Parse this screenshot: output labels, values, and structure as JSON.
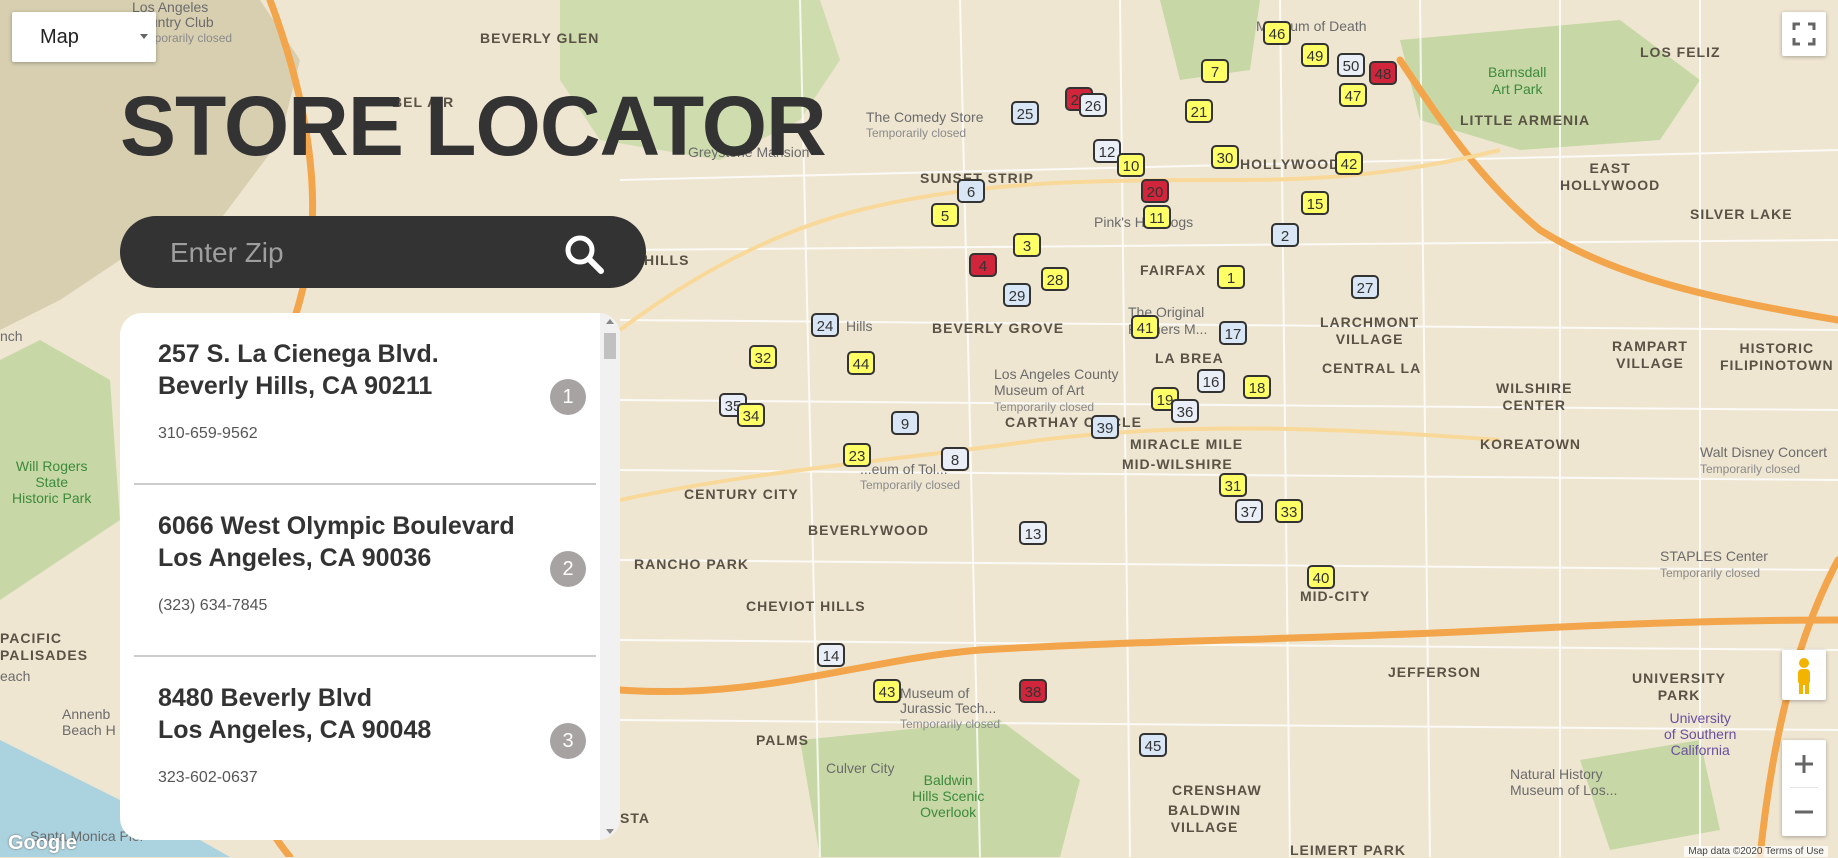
{
  "map_type": {
    "label": "Map"
  },
  "title": "STORE LOCATOR",
  "search": {
    "placeholder": "Enter Zip"
  },
  "stores": [
    {
      "line1": "257 S. La Cienega Blvd.",
      "line2": "Beverly Hills, CA 90211",
      "phone": "310-659-9562",
      "number": "1"
    },
    {
      "line1": "6066 West Olympic Boulevard",
      "line2": "Los Angeles, CA 90036",
      "phone": "(323) 634-7845",
      "number": "2"
    },
    {
      "line1": "8480 Beverly Blvd",
      "line2": "Los Angeles, CA 90048",
      "phone": "323-602-0637",
      "number": "3"
    }
  ],
  "map_labels": {
    "beverly_glen": "BEVERLY GLEN",
    "bel_air": "BEL AIR",
    "los_feliz": "LOS FELIZ",
    "little_armenia": "LITTLE ARMENIA",
    "east_hollywood_1": "EAST",
    "east_hollywood_2": "HOLLYWOOD",
    "silver_lake": "SILVER LAKE",
    "sunset_strip": "SUNSET STRIP",
    "hollywood": "HOLLYWOOD",
    "fairfax": "FAIRFAX",
    "beverly_grove": "BEVERLY GROVE",
    "larchmont_1": "LARCHMONT",
    "larchmont_2": "VILLAGE",
    "central_la": "CENTRAL LA",
    "la_brea": "LA BREA",
    "rampart_1": "RAMPART",
    "rampart_2": "VILLAGE",
    "historic_1": "HISTORIC",
    "historic_2": "FILIPINOTOWN",
    "wilshire_1": "WILSHIRE",
    "wilshire_2": "CENTER",
    "carthay": "CARTHAY CIRCLE",
    "miracle_mile": "MIRACLE MILE",
    "mid_wilshire": "MID-WILSHIRE",
    "koreatown": "KOREATOWN",
    "century_city": "CENTURY CITY",
    "beverlywood": "BEVERLYWOOD",
    "rancho_park": "RANCHO PARK",
    "cheviot_hills": "CHEVIOT HILLS",
    "mid_city": "MID-CITY",
    "jefferson": "JEFFERSON",
    "university_1": "UNIVERSITY",
    "university_2": "PARK",
    "palms": "PALMS",
    "crenshaw": "CRENSHAW",
    "baldwin_1": "BALDWIN",
    "baldwin_2": "VILLAGE",
    "hills": "HILLS",
    "palisades_1": "PACIFIC",
    "palisades_2": "PALISADES",
    "sta": "STA",
    "leimert": "LEIMERT PARK"
  },
  "map_pois": {
    "museum_death": "Museum of Death",
    "barnsdall_1": "Barnsdall",
    "barnsdall_2": "Art Park",
    "comedy_store": "The Comedy Store",
    "comedy_store_sub": "Temporarily closed",
    "pinks": "Pink's Hot Dogs",
    "farmers_1": "The Original",
    "farmers_2": "Farmers M...",
    "lacma_1": "Los Angeles County",
    "lacma_2": "Museum of Art",
    "lacma_sub": "Temporarily closed",
    "will_rogers_1": "Will Rogers",
    "will_rogers_2": "State",
    "will_rogers_3": "Historic Park",
    "disney_1": "Walt Disney Concert",
    "disney_sub": "Temporarily closed",
    "staples_1": "STAPLES Center",
    "staples_sub": "Temporarily closed",
    "usc_1": "University",
    "usc_2": "of Southern",
    "usc_3": "California",
    "nhm_1": "Natural History",
    "nhm_2": "Museum of Los...",
    "culver": "Culver City",
    "baldwin_overlook_1": "Baldwin",
    "baldwin_overlook_2": "Hills Scenic",
    "baldwin_overlook_3": "Overlook",
    "beverly_hills": "Hills",
    "tolerance": "...eum of Tol...",
    "tolerance_sub": "Temporarily closed",
    "jurassic": "Museum of",
    "jurassic_2": "Jurassic Tech...",
    "jurassic_sub": "Temporarily closed",
    "annenberg_1": "Annenb",
    "annenberg_2": "Beach H",
    "santa_monica": "Santa Monica Pier",
    "country_club_1": "Los Angeles",
    "country_club_2": "Country Club",
    "country_club_sub": "Temporarily closed",
    "getty": "Greystone Mansion",
    "each": "each",
    "ench": "nch"
  },
  "markers": [
    "46",
    "50",
    "47",
    "25",
    "12",
    "30",
    "42",
    "20",
    "11",
    "24",
    "32",
    "35",
    "34",
    "9",
    "8",
    "23",
    "40",
    "38",
    "43",
    "45",
    "15",
    "14",
    "31",
    "27",
    "13",
    "1",
    "21",
    "22",
    "10",
    "17",
    "18",
    "16",
    "19",
    "39",
    "37",
    "33",
    "3",
    "4",
    "5",
    "6",
    "7",
    "26",
    "28",
    "29",
    "36",
    "41",
    "44",
    "48",
    "49",
    "2"
  ],
  "map_footer": {
    "google": "Google",
    "attribution": "Map data ©2020  Terms of Use"
  },
  "colors": {
    "panel_bg": "#ffffff",
    "search_bg": "#333333",
    "title": "#333333",
    "badge": "#a8a3a3",
    "map_bg": "#efe6d2",
    "park": "#c7d8a6",
    "highway": "#f2a54a",
    "water": "#aad3df"
  },
  "controls": {
    "fullscreen_icon": "fullscreen-icon",
    "pegman_icon": "pegman-icon",
    "zoom_in": "+",
    "zoom_out": "−"
  }
}
